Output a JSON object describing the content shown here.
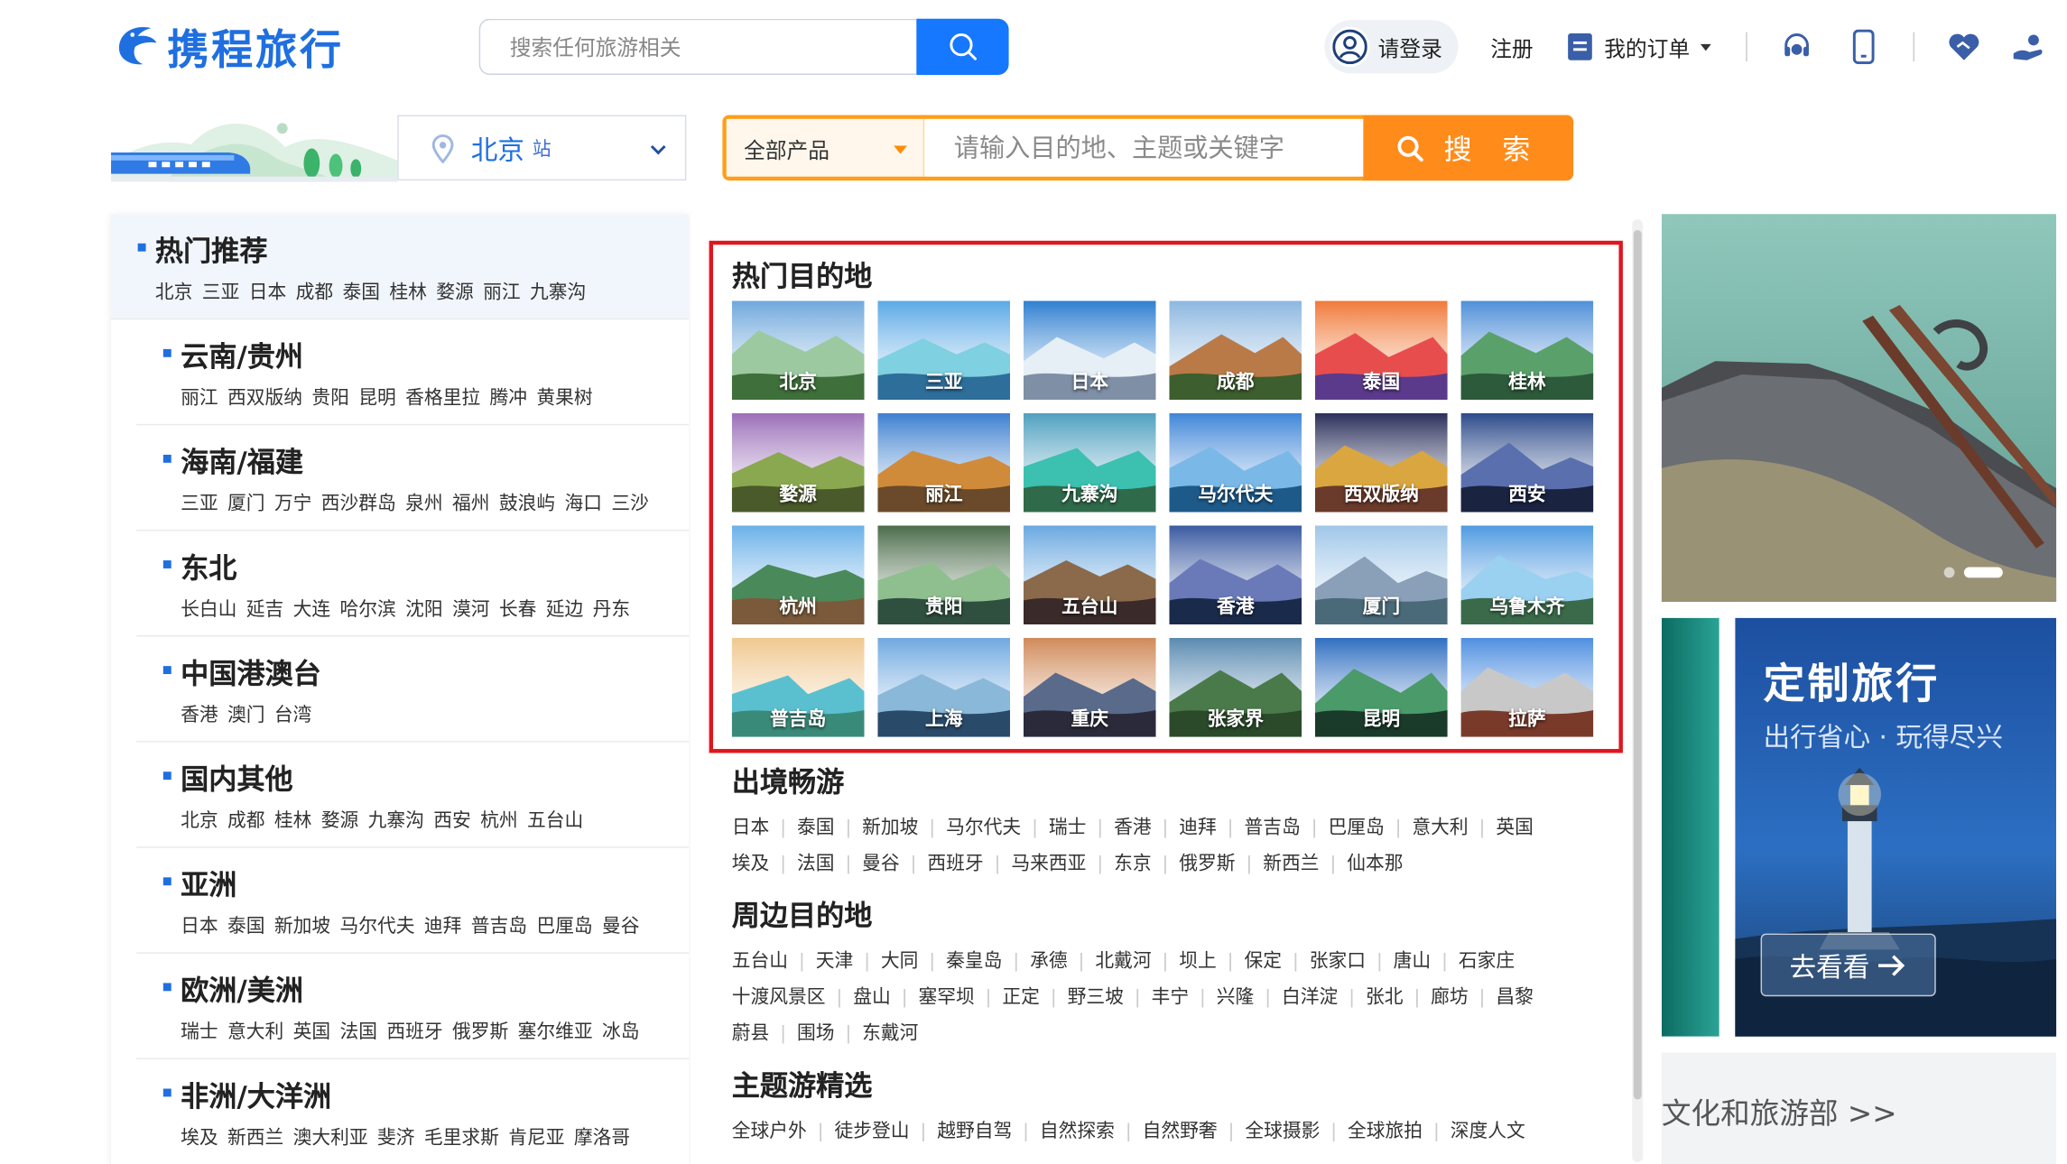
{
  "brand": {
    "name": "携程旅行",
    "color": "#1f6fe0"
  },
  "top_search": {
    "placeholder": "搜索任何旅游相关",
    "button_icon": "search-icon"
  },
  "top_nav": {
    "login": "请登录",
    "register": "注册",
    "orders": "我的订单"
  },
  "station": {
    "city": "北京",
    "suffix": "站"
  },
  "product_search": {
    "category": "全部产品",
    "placeholder": "请输入目的地、主题或关键字",
    "button": "搜 索"
  },
  "categories": [
    {
      "title": "热门推荐",
      "links": [
        "北京",
        "三亚",
        "日本",
        "成都",
        "泰国",
        "桂林",
        "婺源",
        "丽江",
        "九寨沟"
      ]
    },
    {
      "title": "云南/贵州",
      "links": [
        "丽江",
        "西双版纳",
        "贵阳",
        "昆明",
        "香格里拉",
        "腾冲",
        "黄果树"
      ]
    },
    {
      "title": "海南/福建",
      "links": [
        "三亚",
        "厦门",
        "万宁",
        "西沙群岛",
        "泉州",
        "福州",
        "鼓浪屿",
        "海口",
        "三沙"
      ]
    },
    {
      "title": "东北",
      "links": [
        "长白山",
        "延吉",
        "大连",
        "哈尔滨",
        "沈阳",
        "漠河",
        "长春",
        "延边",
        "丹东"
      ]
    },
    {
      "title": "中国港澳台",
      "links": [
        "香港",
        "澳门",
        "台湾"
      ]
    },
    {
      "title": "国内其他",
      "links": [
        "北京",
        "成都",
        "桂林",
        "婺源",
        "九寨沟",
        "西安",
        "杭州",
        "五台山"
      ]
    },
    {
      "title": "亚洲",
      "links": [
        "日本",
        "泰国",
        "新加坡",
        "马尔代夫",
        "迪拜",
        "普吉岛",
        "巴厘岛",
        "曼谷"
      ]
    },
    {
      "title": "欧洲/美洲",
      "links": [
        "瑞士",
        "意大利",
        "英国",
        "法国",
        "西班牙",
        "俄罗斯",
        "塞尔维亚",
        "冰岛"
      ]
    },
    {
      "title": "非洲/大洋洲",
      "links": [
        "埃及",
        "新西兰",
        "澳大利亚",
        "斐济",
        "毛里求斯",
        "肯尼亚",
        "摩洛哥"
      ]
    }
  ],
  "hot_destinations": {
    "title": "热门目的地",
    "items": [
      "北京",
      "三亚",
      "日本",
      "成都",
      "泰国",
      "桂林",
      "婺源",
      "丽江",
      "九寨沟",
      "马尔代夫",
      "西双版纳",
      "西安",
      "杭州",
      "贵阳",
      "五台山",
      "香港",
      "厦门",
      "乌鲁木齐",
      "普吉岛",
      "上海",
      "重庆",
      "张家界",
      "昆明",
      "拉萨"
    ]
  },
  "outbound": {
    "title": "出境畅游",
    "rows": [
      [
        "日本",
        "泰国",
        "新加坡",
        "马尔代夫",
        "瑞士",
        "香港",
        "迪拜",
        "普吉岛",
        "巴厘岛",
        "意大利",
        "英国"
      ],
      [
        "埃及",
        "法国",
        "曼谷",
        "西班牙",
        "马来西亚",
        "东京",
        "俄罗斯",
        "新西兰",
        "仙本那"
      ]
    ]
  },
  "nearby": {
    "title": "周边目的地",
    "rows": [
      [
        "五台山",
        "天津",
        "大同",
        "秦皇岛",
        "承德",
        "北戴河",
        "坝上",
        "保定",
        "张家口",
        "唐山",
        "石家庄"
      ],
      [
        "十渡风景区",
        "盘山",
        "塞罕坝",
        "正定",
        "野三坡",
        "丰宁",
        "兴隆",
        "白洋淀",
        "张北",
        "廊坊",
        "昌黎"
      ],
      [
        "蔚县",
        "围场",
        "东戴河"
      ]
    ]
  },
  "themes": {
    "title": "主题游精选",
    "rows": [
      [
        "全球户外",
        "徒步登山",
        "越野自驾",
        "自然探索",
        "自然野奢",
        "全球摄影",
        "全球旅拍",
        "深度人文"
      ]
    ]
  },
  "custom_banner": {
    "title": "定制旅行",
    "subtitle": "出行省心 · 玩得尽兴",
    "button": "去看看"
  },
  "ministry_link": "文化和旅游部 >>"
}
